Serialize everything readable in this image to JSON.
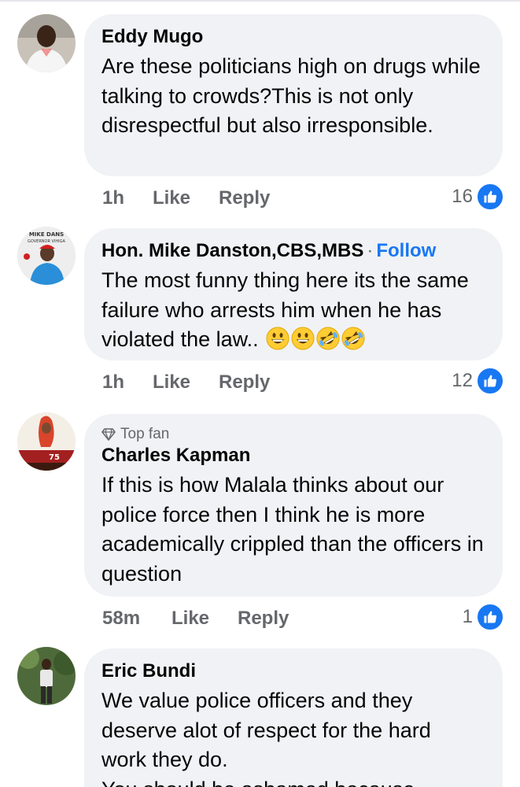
{
  "comments": [
    {
      "author": "Eddy Mugo",
      "text": "Are these politicians high on drugs while talking to crowds?This is not only disrespectful but also irresponsible.",
      "time": "1h",
      "like_label": "Like",
      "reply_label": "Reply",
      "reaction_count": "16"
    },
    {
      "author": "Hon.  Mike Danston,CBS,MBS",
      "separator": "·",
      "follow_label": "Follow",
      "text": "The most funny thing here its the same failure who arrests him when he has violated the law..",
      "emojis": [
        "grinning-face-emoji",
        "grinning-face-emoji",
        "rolling-laughing-emoji",
        "rolling-laughing-emoji"
      ],
      "avatar_caption": "MIKE DANS GOVERNOR VIHIGA",
      "time": "1h",
      "like_label": "Like",
      "reply_label": "Reply",
      "reaction_count": "12"
    },
    {
      "badge": "Top fan",
      "author": "Charles Kapman",
      "text": "If this is how Malala thinks about our police force then I think he is more academically crippled than the officers in question",
      "time": "58m",
      "like_label": "Like",
      "reply_label": "Reply",
      "reaction_count": "1"
    },
    {
      "author": "Eric Bundi",
      "text_lines": [
        "We value police officers and they",
        "deserve alot of respect for the hard",
        "work they do.",
        "You should be ashamed because"
      ]
    }
  ],
  "icons": {
    "like_badge": "thumbs-up-icon",
    "top_fan": "diamond-icon"
  },
  "colors": {
    "bubble_bg": "#f0f2f5",
    "link_blue": "#1877f2",
    "meta_gray": "#65676b",
    "text": "#050505"
  }
}
